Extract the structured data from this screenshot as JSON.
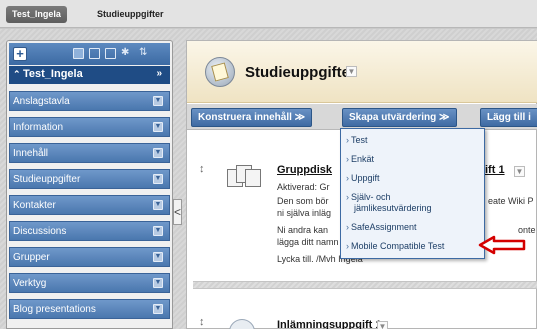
{
  "breadcrumb": {
    "course": "Test_Ingela",
    "page": "Studieuppgifter"
  },
  "course_menu": {
    "course_name": "Test_Ingela",
    "add_label": "+",
    "items": [
      {
        "label": "Anslagstavla"
      },
      {
        "label": "Information"
      },
      {
        "label": "Innehåll"
      },
      {
        "label": "Studieuppgifter"
      },
      {
        "label": "Kontakter"
      },
      {
        "label": "Discussions"
      },
      {
        "label": "Grupper"
      },
      {
        "label": "Verktyg"
      },
      {
        "label": "Blog presentations"
      }
    ],
    "collapse_handle": "<"
  },
  "page": {
    "title": "Studieuppgifter"
  },
  "action_bar": {
    "konstruera": "Konstruera innehåll",
    "skapa": "Skapa utvärdering",
    "lagg_till": "Lägg till i"
  },
  "create_assessment_menu": {
    "items": [
      {
        "label": "Test"
      },
      {
        "label": "Enkät"
      },
      {
        "label": "Uppgift"
      },
      {
        "label": "Själv- och",
        "label2": "jämlikesutvärdering"
      },
      {
        "label": "SafeAssignment"
      },
      {
        "label": "Mobile Compatible Test"
      }
    ]
  },
  "items": [
    {
      "title_left": "Gruppdisk",
      "title_right": "ift 1",
      "status": "Aktiverad: Gr",
      "desc_line1_left": "Den som bör",
      "desc_line1_right": "eate Wiki P",
      "desc_line2": "ni själva inläg",
      "desc_line3_left": "Ni andra kan",
      "desc_line3_right": "onte",
      "desc_line4": "lägga ditt namn efter ditt inlägg.",
      "signoff": "Lycka till. /Mvh Ingela"
    },
    {
      "title": "Inlämningsuppgift 1"
    }
  ],
  "colors": {
    "menu_blue": "#4a77ae",
    "course_header": "#1f4c85",
    "highlight_arrow": "#d40000"
  }
}
